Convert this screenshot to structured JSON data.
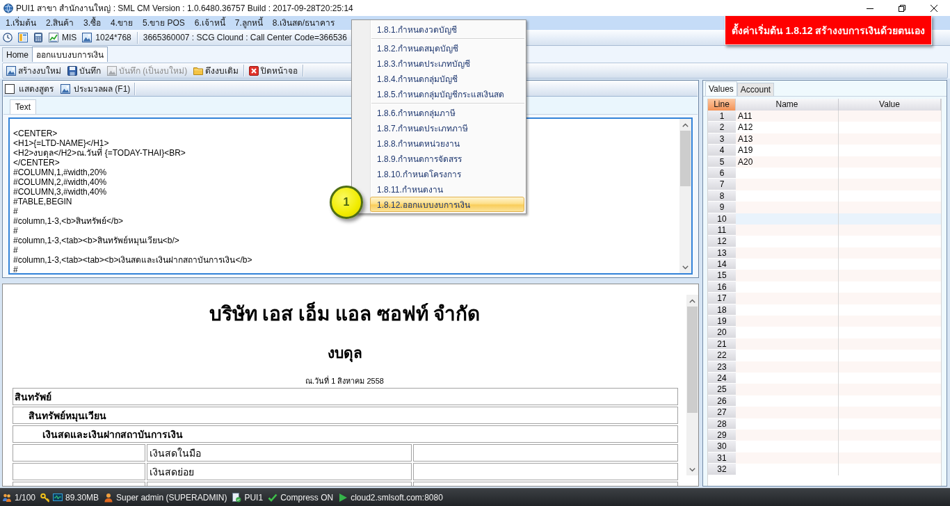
{
  "title_bar": {
    "title": "PUI1 สาขา สำนักงานใหญ่ : SML CM Version : 1.0.6480.36757 Build : 2017-09-28T20:25:14"
  },
  "menu_bar": {
    "items": [
      "1.เริ่มต้น",
      "2.สินค้า",
      "3.ซื้อ",
      "4.ขาย",
      "5.ขาย POS",
      "6.เจ้าหนี้",
      "7.ลูกหนี้",
      "8.เงินสด/ธนาคาร"
    ]
  },
  "info_bar": {
    "buttons": [
      {
        "kind": "mis",
        "label": "MIS"
      },
      {
        "kind": "screen",
        "label": "1024*768"
      }
    ],
    "connection": "3665360007 : SCG Clound : Call Center Code=366536"
  },
  "tabs": [
    {
      "label": "Home",
      "selected": false
    },
    {
      "label": "ออกแบบงบการเงิน",
      "selected": true
    }
  ],
  "toolbar": {
    "groups": [
      [
        {
          "kind": "new",
          "label": "สร้างงบใหม่",
          "disabled": false
        },
        {
          "kind": "save",
          "label": "บันทึก",
          "disabled": false
        },
        {
          "kind": "save_as",
          "label": "บันทึก (เป็นงบใหม่)",
          "disabled": true
        },
        {
          "kind": "open",
          "label": "ดึงงบเดิม",
          "disabled": false
        }
      ],
      [
        {
          "kind": "close",
          "label": "ปิดหน้าจอ",
          "disabled": false
        }
      ]
    ]
  },
  "editor": {
    "show_formula": {
      "label": "แสดงสูตร",
      "checked": false
    },
    "process_button": "ประมวลผล (F1)",
    "tabs": [
      {
        "label": "Text",
        "selected": true
      }
    ],
    "lines": [
      "<CENTER>",
      "<H1>{=LTD-NAME}</H1>",
      "<H2>งบดุล</H2>ณ.วันที่ {=TODAY-THAI}<BR>",
      "</CENTER>",
      "#COLUMN,1,#width,20%",
      "#COLUMN,2,#width,40%",
      "#COLUMN,3,#width,40%",
      "#TABLE,BEGIN",
      "#",
      "#column,1-3,<b>สินทรัพย์</b>",
      "#",
      "#column,1-3,<tab><b>สินทรัพย์หมุนเวียน<b/>",
      "#",
      "#column,1-3,<tab><tab><b>เงินสดและเงินฝากสถาบันการเงิน</b>",
      "#"
    ]
  },
  "preview": {
    "company": "บริษัท เอส เอ็ม แอล ซอฟท์ จำกัด",
    "heading": "งบดุล",
    "date": "ณ.วันที่ 1 สิงหาคม 2558",
    "sections": [
      {
        "title": "สินทรัพย์",
        "children": [
          {
            "title": "สินทรัพย์หมุนเวียน",
            "children": [
              {
                "title": "เงินสดและเงินฝากสถาบันการเงิน",
                "lines": [
                  {
                    "column_2": "เงินสดในมือ"
                  },
                  {
                    "column_2": "เงินสดย่อย"
                  }
                ]
              }
            ]
          }
        ]
      }
    ]
  },
  "values_panel": {
    "tabs": [
      {
        "label": "Values",
        "selected": true
      },
      {
        "label": "Account",
        "selected": false
      }
    ],
    "columns": [
      {
        "label": "Line",
        "active": true
      },
      {
        "label": "Name",
        "active": false
      },
      {
        "label": "Value",
        "active": false
      }
    ],
    "rows": [
      {
        "line": "1",
        "name": "A11",
        "selected": false
      },
      {
        "line": "2",
        "name": "A12",
        "selected": false
      },
      {
        "line": "3",
        "name": "A13",
        "selected": false
      },
      {
        "line": "4",
        "name": "A19",
        "selected": false
      },
      {
        "line": "5",
        "name": "A20",
        "selected": false
      },
      {
        "line": "6",
        "selected": false
      },
      {
        "line": "7",
        "selected": false
      },
      {
        "line": "8",
        "selected": false
      },
      {
        "line": "9",
        "selected": false
      },
      {
        "line": "10",
        "selected": true
      },
      {
        "line": "11",
        "selected": false
      },
      {
        "line": "12",
        "selected": false
      },
      {
        "line": "13",
        "selected": false
      },
      {
        "line": "14",
        "selected": false
      },
      {
        "line": "15",
        "selected": false
      },
      {
        "line": "16",
        "selected": false
      },
      {
        "line": "17",
        "selected": false
      },
      {
        "line": "18",
        "selected": false
      },
      {
        "line": "19",
        "selected": false
      },
      {
        "line": "20",
        "selected": false
      },
      {
        "line": "21",
        "selected": false
      },
      {
        "line": "22",
        "selected": false
      },
      {
        "line": "23",
        "selected": false
      },
      {
        "line": "24",
        "selected": false
      },
      {
        "line": "25",
        "selected": false
      },
      {
        "line": "26",
        "selected": false
      },
      {
        "line": "27",
        "selected": false
      },
      {
        "line": "28",
        "selected": false
      },
      {
        "line": "29",
        "selected": false
      },
      {
        "line": "30",
        "selected": false
      },
      {
        "line": "31",
        "selected": false
      },
      {
        "line": "32",
        "selected": false
      }
    ]
  },
  "menu_popup": {
    "groups": [
      [
        {
          "label": "1.8.1.กำหนดงวดบัญชี",
          "selected": false
        }
      ],
      [
        {
          "label": "1.8.2.กำหนดสมุดบัญชี",
          "selected": false
        },
        {
          "label": "1.8.3.กำหนดประเภทบัญชี",
          "selected": false
        },
        {
          "label": "1.8.4.กำหนดกลุ่มบัญชี",
          "selected": false
        },
        {
          "label": "1.8.5.กำหนดกลุ่มบัญชีกระแสเงินสด",
          "selected": false
        }
      ],
      [
        {
          "label": "1.8.6.กำหนดกลุ่มภาษี",
          "selected": false
        },
        {
          "label": "1.8.7.กำหนดประเภทภาษี",
          "selected": false
        },
        {
          "label": "1.8.8.กำหนดหน่วยงาน",
          "selected": false
        },
        {
          "label": "1.8.9.กำหนดการจัดสรร",
          "selected": false
        },
        {
          "label": "1.8.10.กำหนดโครงการ",
          "selected": false
        },
        {
          "label": "1.8.11.กำหนดงาน",
          "selected": false
        },
        {
          "label": "1.8.12.ออกแบบงบการเงิน",
          "selected": true
        }
      ]
    ]
  },
  "callout": {
    "number": "1"
  },
  "banner": {
    "text": "ตั้งค่าเริ่มต้น 1.8.12 สร้างงบการเงินด้วยตนเอง"
  },
  "status_bar": {
    "items": [
      {
        "kind": "sessions",
        "text": "1/100"
      },
      {
        "kind": "memory",
        "text": "89.30MB"
      },
      {
        "kind": "user",
        "text": "Super admin (SUPERADMIN)"
      },
      {
        "kind": "branch",
        "text": "PUI1"
      },
      {
        "kind": "compress",
        "text": "Compress ON"
      },
      {
        "kind": "server",
        "text": "cloud2.smlsoft.com:8080"
      }
    ]
  }
}
